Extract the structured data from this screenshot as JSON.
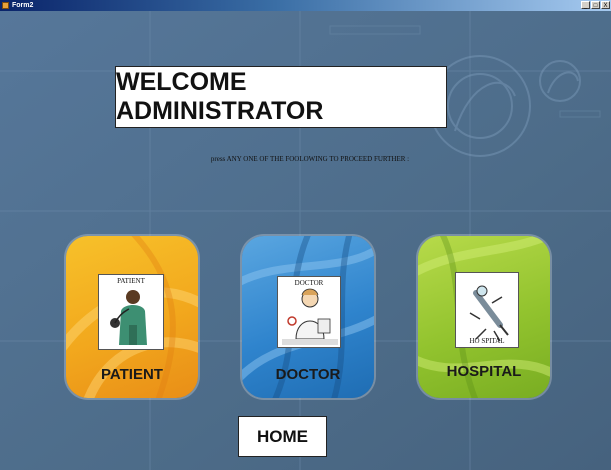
{
  "window": {
    "title": "Form2",
    "controls": [
      "_",
      "□",
      "X"
    ]
  },
  "header": {
    "welcome": "WELCOME ADMINISTRATOR",
    "instruction": "press ANY ONE OF THE FOOLOWING TO PROCEED FURTHER :"
  },
  "tiles": [
    {
      "label": "PATIENT",
      "picture_caption": "PATIENT",
      "icon": "patient-icon",
      "color": "#f2a81d"
    },
    {
      "label": "DOCTOR",
      "picture_caption": "DOCTOR",
      "icon": "doctor-icon",
      "color": "#2f84cd"
    },
    {
      "label": "HOSPITAL",
      "picture_caption": "HO SPITAL",
      "icon": "hospital-icon",
      "color": "#92c32e"
    }
  ],
  "home": {
    "label": "HOME"
  },
  "colors": {
    "background": "#4f6f8d",
    "titlebar": "#0a246a"
  }
}
